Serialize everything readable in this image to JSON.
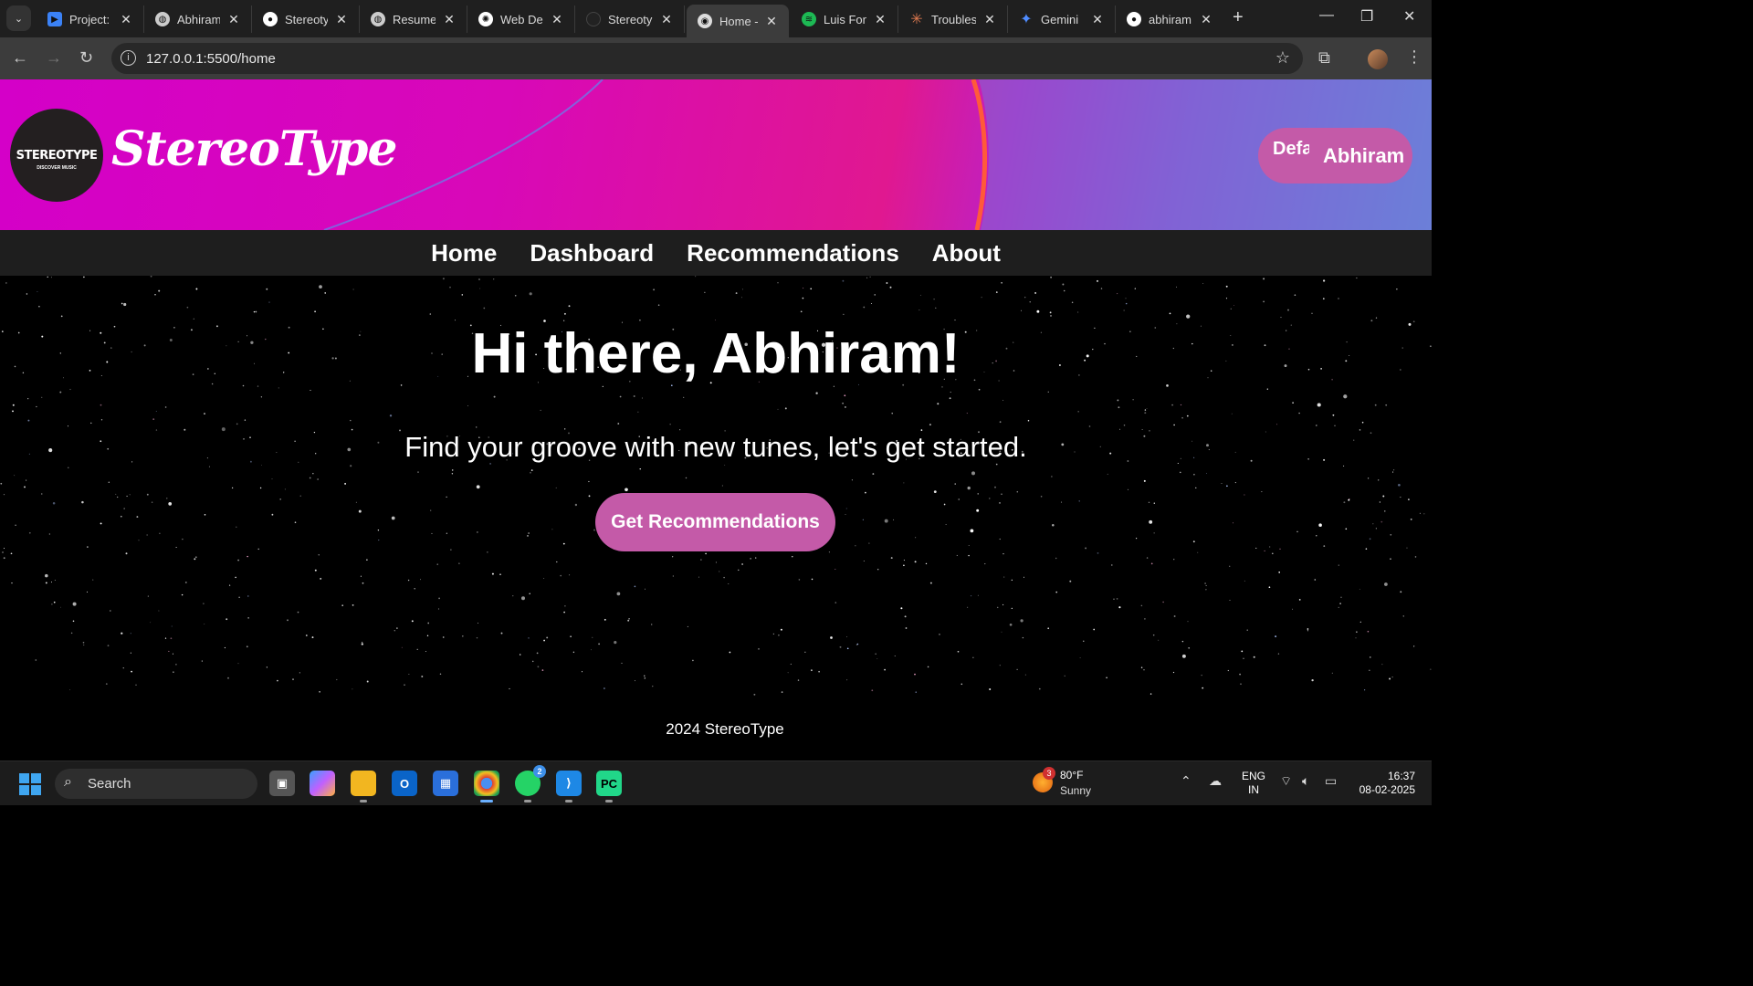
{
  "browser": {
    "tabs": [
      {
        "label": "Project: C",
        "favicon": "youtube-studio-icon",
        "color": "#3b82f6"
      },
      {
        "label": "Abhiram",
        "favicon": "globe-icon",
        "color": "#cccccc"
      },
      {
        "label": "Stereoty",
        "favicon": "github-icon",
        "color": "#ffffff"
      },
      {
        "label": "Resume",
        "favicon": "globe-icon",
        "color": "#cccccc"
      },
      {
        "label": "Web De",
        "favicon": "openai-icon",
        "color": "#ffffff"
      },
      {
        "label": "Stereoty",
        "favicon": "dark-circle-icon",
        "color": "#222222"
      },
      {
        "label": "Home - S",
        "favicon": "stereotype-icon",
        "color": "#dddddd",
        "active": true
      },
      {
        "label": "Luis Fon",
        "favicon": "spotify-icon",
        "color": "#1db954"
      },
      {
        "label": "Troubles",
        "favicon": "claude-icon",
        "color": "#d9774e"
      },
      {
        "label": "Gemini",
        "favicon": "gemini-icon",
        "color": "#4f8cff"
      },
      {
        "label": "abhiram",
        "favicon": "github-icon",
        "color": "#ffffff"
      }
    ],
    "url": "127.0.0.1:5500/home"
  },
  "header": {
    "logo_text": "STEREOTYPE",
    "logo_subtext": "DISCOVER MUSIC",
    "brand": "StereoType",
    "user_avatar_alt": "Defa",
    "user_name": "Abhiram"
  },
  "nav": {
    "items": [
      "Home",
      "Dashboard",
      "Recommendations",
      "About"
    ]
  },
  "hero": {
    "title": "Hi there, Abhiram!",
    "subtitle": "Find your groove with new tunes, let's get started.",
    "cta_label": "Get Recommendations"
  },
  "footer": {
    "text": "2024 StereoType"
  },
  "taskbar": {
    "search_label": "Search",
    "weather_badge": "3",
    "temperature": "80°F",
    "condition": "Sunny",
    "whatsapp_badge": "2",
    "lang_line1": "ENG",
    "lang_line2": "IN",
    "time": "16:37",
    "date": "08-02-2025"
  },
  "colors": {
    "accent_pink": "#c45aa8",
    "nav_bg": "#1e1e1e"
  }
}
